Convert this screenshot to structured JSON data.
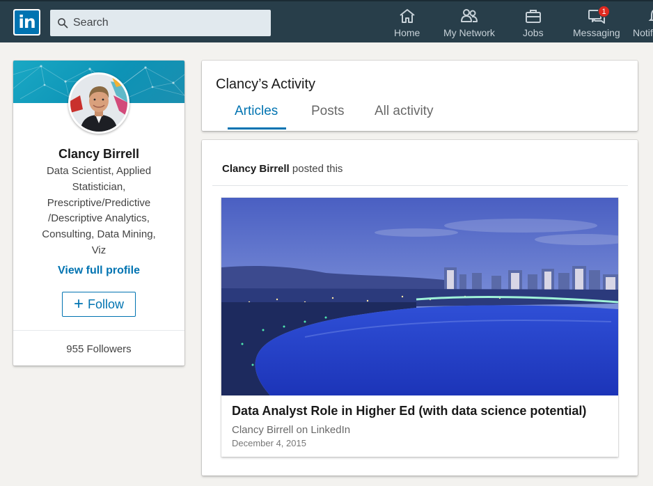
{
  "nav": {
    "search_placeholder": "Search",
    "items": [
      {
        "label": "Home",
        "icon": "home-icon"
      },
      {
        "label": "My Network",
        "icon": "network-icon"
      },
      {
        "label": "Jobs",
        "icon": "jobs-icon"
      },
      {
        "label": "Messaging",
        "icon": "messaging-icon",
        "badge": "1"
      },
      {
        "label": "Notifi",
        "icon": "notifications-icon"
      }
    ],
    "colors": {
      "bar": "#283e4a",
      "brand": "#0073b1",
      "badge": "#e0291f"
    }
  },
  "profile": {
    "name": "Clancy Birrell",
    "headline": "Data Scientist, Applied Statistician, Prescriptive/Predictive /Descriptive Analytics, Consulting, Data Mining, Viz",
    "view_profile": "View full profile",
    "follow_label": "Follow",
    "followers": "955 Followers"
  },
  "activity": {
    "title": "Clancy’s Activity",
    "tabs": [
      {
        "label": "Articles",
        "active": true
      },
      {
        "label": "Posts",
        "active": false
      },
      {
        "label": "All activity",
        "active": false
      }
    ]
  },
  "feed": {
    "author": "Clancy Birrell",
    "action": "posted this",
    "article": {
      "title": "Data Analyst Role in Higher Ed (with data science potential)",
      "source": "Clancy Birrell on LinkedIn",
      "date": "December 4, 2015"
    }
  }
}
